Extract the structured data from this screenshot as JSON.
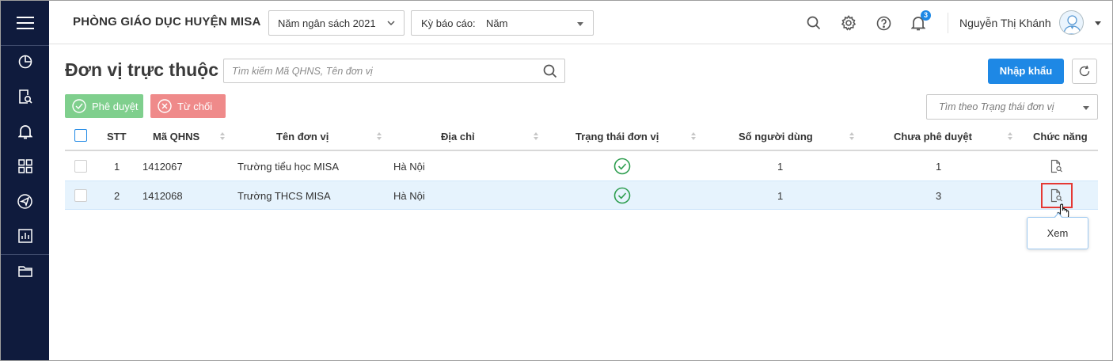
{
  "header": {
    "org_name": "PHÒNG GIÁO DỤC HUYỆN MISA",
    "budget_year": "Năm ngân sách 2021",
    "period_label": "Kỳ báo cáo:",
    "period_value": "Năm",
    "notification_count": "3",
    "user_name": "Nguyễn Thị Khánh"
  },
  "sidebar": {
    "items": [
      "menu-icon",
      "dashboard-icon",
      "document-search-icon",
      "bell-icon",
      "grid-icon",
      "send-icon",
      "report-icon",
      "folder-icon"
    ]
  },
  "page": {
    "title": "Đơn vị trực thuộc",
    "search_placeholder": "Tìm kiếm Mã QHNS, Tên đơn vị",
    "import_label": "Nhập khẩu",
    "approve_label": "Phê duyệt",
    "reject_label": "Từ chối",
    "status_filter_placeholder": "Tìm theo Trạng thái đơn vị"
  },
  "table": {
    "columns": {
      "stt": "STT",
      "code": "Mã QHNS",
      "name": "Tên đơn vị",
      "address": "Địa chỉ",
      "status": "Trạng thái đơn vị",
      "users": "Số người dùng",
      "pending": "Chưa phê duyệt",
      "actions": "Chức năng"
    },
    "rows": [
      {
        "stt": "1",
        "code": "1412067",
        "name": "Trường tiểu học MISA",
        "address": "Hà Nội",
        "status": "active",
        "users": "1",
        "pending": "1"
      },
      {
        "stt": "2",
        "code": "1412068",
        "name": "Trường THCS MISA",
        "address": "Hà Nội",
        "status": "active",
        "users": "1",
        "pending": "3"
      }
    ],
    "tooltip": "Xem"
  },
  "colors": {
    "sidebar_bg": "#0f1b3d",
    "primary": "#1e88e5",
    "approve": "#7fcf8d",
    "reject": "#ef8a8a",
    "selected_row": "#e6f3fd",
    "status_ok": "#2e9e4f",
    "highlight": "#e53935"
  }
}
